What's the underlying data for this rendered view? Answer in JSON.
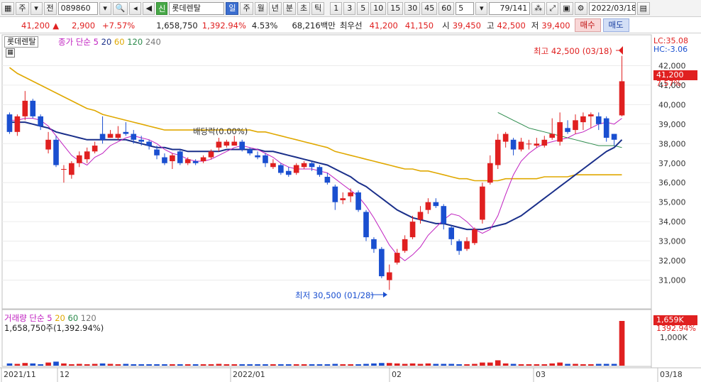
{
  "toolbar": {
    "period_label": "주",
    "prev_label": "전",
    "code": "089860",
    "new_tag": "신",
    "stock_name": "롯데렌탈",
    "periods": [
      "일",
      "주",
      "월",
      "년",
      "분",
      "초",
      "틱"
    ],
    "minutes": [
      "1",
      "3",
      "5",
      "10",
      "15",
      "30",
      "45",
      "60"
    ],
    "interval_value": "5",
    "page_counter": "79/141",
    "date": "2022/03/18"
  },
  "quote": {
    "price": "41,200",
    "arrow": "▲",
    "change": "2,900",
    "change_pct": "+7.57%",
    "volume": "1,658,750",
    "volume_pct": "1,392.94%",
    "turnover_pct": "4.53%",
    "amount": "68,216백만",
    "best_label": "최우선",
    "best_ask": "41,200",
    "best_bid": "41,150",
    "open_label": "시",
    "open": "39,450",
    "high_label": "고",
    "high": "42,500",
    "low_label": "저",
    "low": "39,400",
    "buy_label": "매수",
    "sell_label": "매도"
  },
  "legend": {
    "name": "롯데렌탈",
    "ma_label": "종가 단순",
    "ma_periods": [
      "5",
      "20",
      "60",
      "120",
      "240"
    ],
    "vol_label": "거래량 단순",
    "vol_periods": [
      "5",
      "20",
      "60",
      "120"
    ],
    "vol_value": "1,658,750주(1,392.94%)"
  },
  "annotations": {
    "high": "최고 42,500 (03/18)",
    "low": "최저 30,500 (01/28)",
    "dividend": "배당락(0.00%)",
    "lc": "LC:35.08",
    "hc": "HC:-3.06",
    "price_tag": "41,200",
    "price_tag_pct": "7.57%",
    "vol_tag": "1,659K",
    "vol_tag_pct": "1392.94%"
  },
  "colors": {
    "up": "#e02020",
    "down": "#1a4fd0",
    "ma5": "#c020c0",
    "ma20": "#1a2f8a",
    "ma60": "#e0a800",
    "ma120": "#2a8a4a"
  },
  "chart_data": {
    "type": "candlestick",
    "price_ticks": [
      31000,
      32000,
      33000,
      34000,
      35000,
      36000,
      37000,
      38000,
      39000,
      40000,
      41000,
      42000
    ],
    "price_tick_labels": [
      "31,000",
      "32,000",
      "33,000",
      "34,000",
      "35,000",
      "36,000",
      "37,000",
      "38,000",
      "39,000",
      "40,000",
      "41,000",
      "42,000"
    ],
    "ylim": [
      30000,
      43000
    ],
    "vol_tick_label": "1,000K",
    "x_labels": [
      "2021/11",
      "12",
      "2022/01",
      "02",
      "03",
      "03/18"
    ],
    "candles": [
      [
        39500,
        38600,
        39600,
        38500
      ],
      [
        38600,
        39400,
        39500,
        38400
      ],
      [
        39400,
        40200,
        40700,
        39200
      ],
      [
        40200,
        39400,
        40300,
        39300
      ],
      [
        39400,
        38900,
        39500,
        38700
      ],
      [
        37700,
        38200,
        38600,
        37500
      ],
      [
        38200,
        36900,
        38400,
        36800
      ],
      [
        36700,
        36700,
        36900,
        36000
      ],
      [
        36400,
        37000,
        37100,
        36200
      ],
      [
        37000,
        37400,
        37600,
        36800
      ],
      [
        37200,
        37600,
        37800,
        37000
      ],
      [
        37600,
        37900,
        38100,
        37500
      ],
      [
        38500,
        38200,
        39400,
        38000
      ],
      [
        38300,
        38500,
        38700,
        38300
      ],
      [
        38300,
        38500,
        38900,
        38200
      ],
      [
        38600,
        38500,
        39100,
        38400
      ],
      [
        38500,
        38200,
        38700,
        38000
      ],
      [
        38200,
        38100,
        38400,
        37900
      ],
      [
        38100,
        37900,
        38200,
        37700
      ],
      [
        37700,
        37400,
        37900,
        37200
      ],
      [
        37300,
        37000,
        37500,
        36900
      ],
      [
        37100,
        37400,
        37500,
        36700
      ],
      [
        37600,
        37000,
        37700,
        36900
      ],
      [
        37000,
        37200,
        37300,
        36900
      ],
      [
        37100,
        37000,
        37200,
        36900
      ],
      [
        37100,
        37300,
        37400,
        37000
      ],
      [
        37300,
        37600,
        37700,
        37200
      ],
      [
        37800,
        38100,
        38300,
        37600
      ],
      [
        37900,
        38100,
        38200,
        37800
      ],
      [
        37900,
        38100,
        38400,
        37900
      ],
      [
        38100,
        37700,
        38200,
        37600
      ],
      [
        37700,
        37500,
        37800,
        37400
      ],
      [
        37400,
        37300,
        37600,
        37200
      ],
      [
        37400,
        37000,
        37500,
        36800
      ],
      [
        36800,
        37000,
        37200,
        36700
      ],
      [
        36900,
        36500,
        37000,
        36400
      ],
      [
        36600,
        36400,
        36800,
        36300
      ],
      [
        36500,
        36900,
        37000,
        36400
      ],
      [
        36800,
        37000,
        37100,
        36700
      ],
      [
        37000,
        36800,
        37100,
        36600
      ],
      [
        36800,
        36400,
        36900,
        36300
      ],
      [
        36300,
        36000,
        36500,
        35900
      ],
      [
        35800,
        35000,
        35900,
        34600
      ],
      [
        35100,
        35200,
        35500,
        34900
      ],
      [
        35300,
        35500,
        35700,
        35000
      ],
      [
        35500,
        34600,
        35600,
        34500
      ],
      [
        34500,
        33200,
        34600,
        33000
      ],
      [
        33100,
        32600,
        33200,
        32400
      ],
      [
        32600,
        31200,
        32700,
        31100
      ],
      [
        31000,
        31400,
        31800,
        30500
      ],
      [
        31900,
        32400,
        32600,
        31800
      ],
      [
        32500,
        33100,
        33300,
        32400
      ],
      [
        33200,
        34000,
        34300,
        33100
      ],
      [
        34100,
        34500,
        34800,
        33900
      ],
      [
        34600,
        35000,
        35200,
        34400
      ],
      [
        35000,
        34800,
        35200,
        34700
      ],
      [
        34800,
        33900,
        34900,
        33600
      ],
      [
        33700,
        33100,
        33800,
        32800
      ],
      [
        33000,
        32500,
        33100,
        32300
      ],
      [
        32600,
        33000,
        33200,
        32500
      ],
      [
        32900,
        33600,
        33700,
        32800
      ],
      [
        34100,
        35800,
        36000,
        33900
      ],
      [
        36000,
        37000,
        37400,
        35900
      ],
      [
        36900,
        38200,
        38500,
        36700
      ],
      [
        38100,
        38500,
        38600,
        37800
      ],
      [
        38200,
        37700,
        38300,
        37400
      ],
      [
        37700,
        38100,
        38300,
        37600
      ],
      [
        38000,
        38000,
        38200,
        37700
      ],
      [
        37900,
        38000,
        38300,
        37800
      ],
      [
        37900,
        38200,
        38400,
        37800
      ],
      [
        38300,
        38500,
        39300,
        38200
      ],
      [
        38100,
        39100,
        39600,
        37900
      ],
      [
        38800,
        38600,
        39200,
        38500
      ],
      [
        38700,
        39200,
        39500,
        38500
      ],
      [
        39100,
        39400,
        39600,
        38700
      ],
      [
        39400,
        39500,
        39600,
        38800
      ],
      [
        39400,
        39000,
        39600,
        38700
      ],
      [
        39300,
        38300,
        39400,
        38100
      ],
      [
        38500,
        38200,
        38500,
        37900
      ],
      [
        39450,
        41200,
        42500,
        39400
      ]
    ],
    "vol_rel": [
      0.05,
      0.04,
      0.06,
      0.05,
      0.03,
      0.07,
      0.09,
      0.05,
      0.03,
      0.04,
      0.03,
      0.04,
      0.05,
      0.04,
      0.03,
      0.04,
      0.03,
      0.03,
      0.03,
      0.02,
      0.03,
      0.03,
      0.03,
      0.02,
      0.02,
      0.03,
      0.03,
      0.04,
      0.03,
      0.03,
      0.03,
      0.02,
      0.02,
      0.03,
      0.02,
      0.03,
      0.02,
      0.03,
      0.02,
      0.02,
      0.03,
      0.03,
      0.04,
      0.03,
      0.03,
      0.03,
      0.04,
      0.05,
      0.06,
      0.06,
      0.05,
      0.04,
      0.05,
      0.04,
      0.05,
      0.04,
      0.04,
      0.04,
      0.03,
      0.03,
      0.04,
      0.07,
      0.07,
      0.12,
      0.05,
      0.04,
      0.03,
      0.03,
      0.03,
      0.03,
      0.05,
      0.07,
      0.04,
      0.04,
      0.03,
      0.03,
      0.04,
      0.04,
      0.04,
      1.0
    ],
    "ma5": [
      39200,
      39200,
      39300,
      39300,
      39200,
      38900,
      38400,
      37900,
      37400,
      37100,
      36900,
      37300,
      37500,
      37900,
      38100,
      38300,
      38400,
      38300,
      38200,
      38000,
      37700,
      37500,
      37400,
      37200,
      37100,
      37100,
      37200,
      37400,
      37600,
      37800,
      37900,
      37800,
      37700,
      37500,
      37300,
      37000,
      36800,
      36700,
      36700,
      36700,
      36600,
      36500,
      36200,
      35900,
      35600,
      35300,
      34800,
      34200,
      33500,
      32800,
      32300,
      32000,
      32300,
      32700,
      33300,
      33700,
      34100,
      34400,
      34300,
      34000,
      33600,
      33400,
      33600,
      34300,
      35400,
      36400,
      37100,
      37500,
      37800,
      38000,
      38100,
      38200,
      38300,
      38500,
      38600,
      38800,
      39000,
      39100,
      39000,
      39300
    ],
    "ma20": [
      39100,
      39100,
      39100,
      39000,
      38900,
      38800,
      38600,
      38500,
      38400,
      38300,
      38200,
      38200,
      38200,
      38200,
      38200,
      38200,
      38100,
      38000,
      37900,
      37800,
      37800,
      37700,
      37700,
      37600,
      37600,
      37600,
      37600,
      37600,
      37700,
      37700,
      37700,
      37700,
      37700,
      37600,
      37600,
      37500,
      37400,
      37300,
      37200,
      37100,
      37000,
      36900,
      36700,
      36500,
      36300,
      36000,
      35800,
      35500,
      35200,
      34900,
      34600,
      34400,
      34200,
      34100,
      34000,
      33900,
      33900,
      33800,
      33700,
      33600,
      33600,
      33600,
      33700,
      33800,
      33900,
      34100,
      34300,
      34600,
      34900,
      35200,
      35500,
      35800,
      36100,
      36400,
      36700,
      37000,
      37300,
      37600,
      37800,
      38200
    ],
    "ma60": [
      41900,
      41600,
      41400,
      41200,
      41000,
      40800,
      40600,
      40400,
      40200,
      40000,
      39800,
      39700,
      39500,
      39400,
      39300,
      39200,
      39100,
      39000,
      38900,
      38800,
      38700,
      38700,
      38700,
      38700,
      38700,
      38700,
      38700,
      38700,
      38700,
      38700,
      38700,
      38700,
      38600,
      38600,
      38500,
      38400,
      38300,
      38200,
      38100,
      38000,
      37900,
      37800,
      37600,
      37500,
      37400,
      37300,
      37200,
      37100,
      37000,
      36900,
      36800,
      36700,
      36700,
      36600,
      36600,
      36500,
      36400,
      36300,
      36200,
      36200,
      36100,
      36100,
      36100,
      36100,
      36200,
      36200,
      36200,
      36200,
      36200,
      36300,
      36300,
      36300,
      36300,
      36400,
      36400,
      36400,
      36400,
      36400,
      36400,
      36400
    ],
    "ma120": [
      null,
      null,
      null,
      null,
      null,
      null,
      null,
      null,
      null,
      null,
      null,
      null,
      null,
      null,
      null,
      null,
      null,
      null,
      null,
      null,
      null,
      null,
      null,
      null,
      null,
      null,
      null,
      null,
      null,
      null,
      null,
      null,
      null,
      null,
      null,
      null,
      null,
      null,
      null,
      null,
      null,
      null,
      null,
      null,
      null,
      null,
      null,
      null,
      null,
      null,
      null,
      null,
      null,
      null,
      null,
      null,
      null,
      null,
      null,
      null,
      null,
      null,
      null,
      39600,
      39400,
      39200,
      39000,
      38800,
      38700,
      38600,
      38500,
      38400,
      38300,
      38200,
      38100,
      38000,
      37900,
      37900,
      37900,
      37800
    ]
  }
}
